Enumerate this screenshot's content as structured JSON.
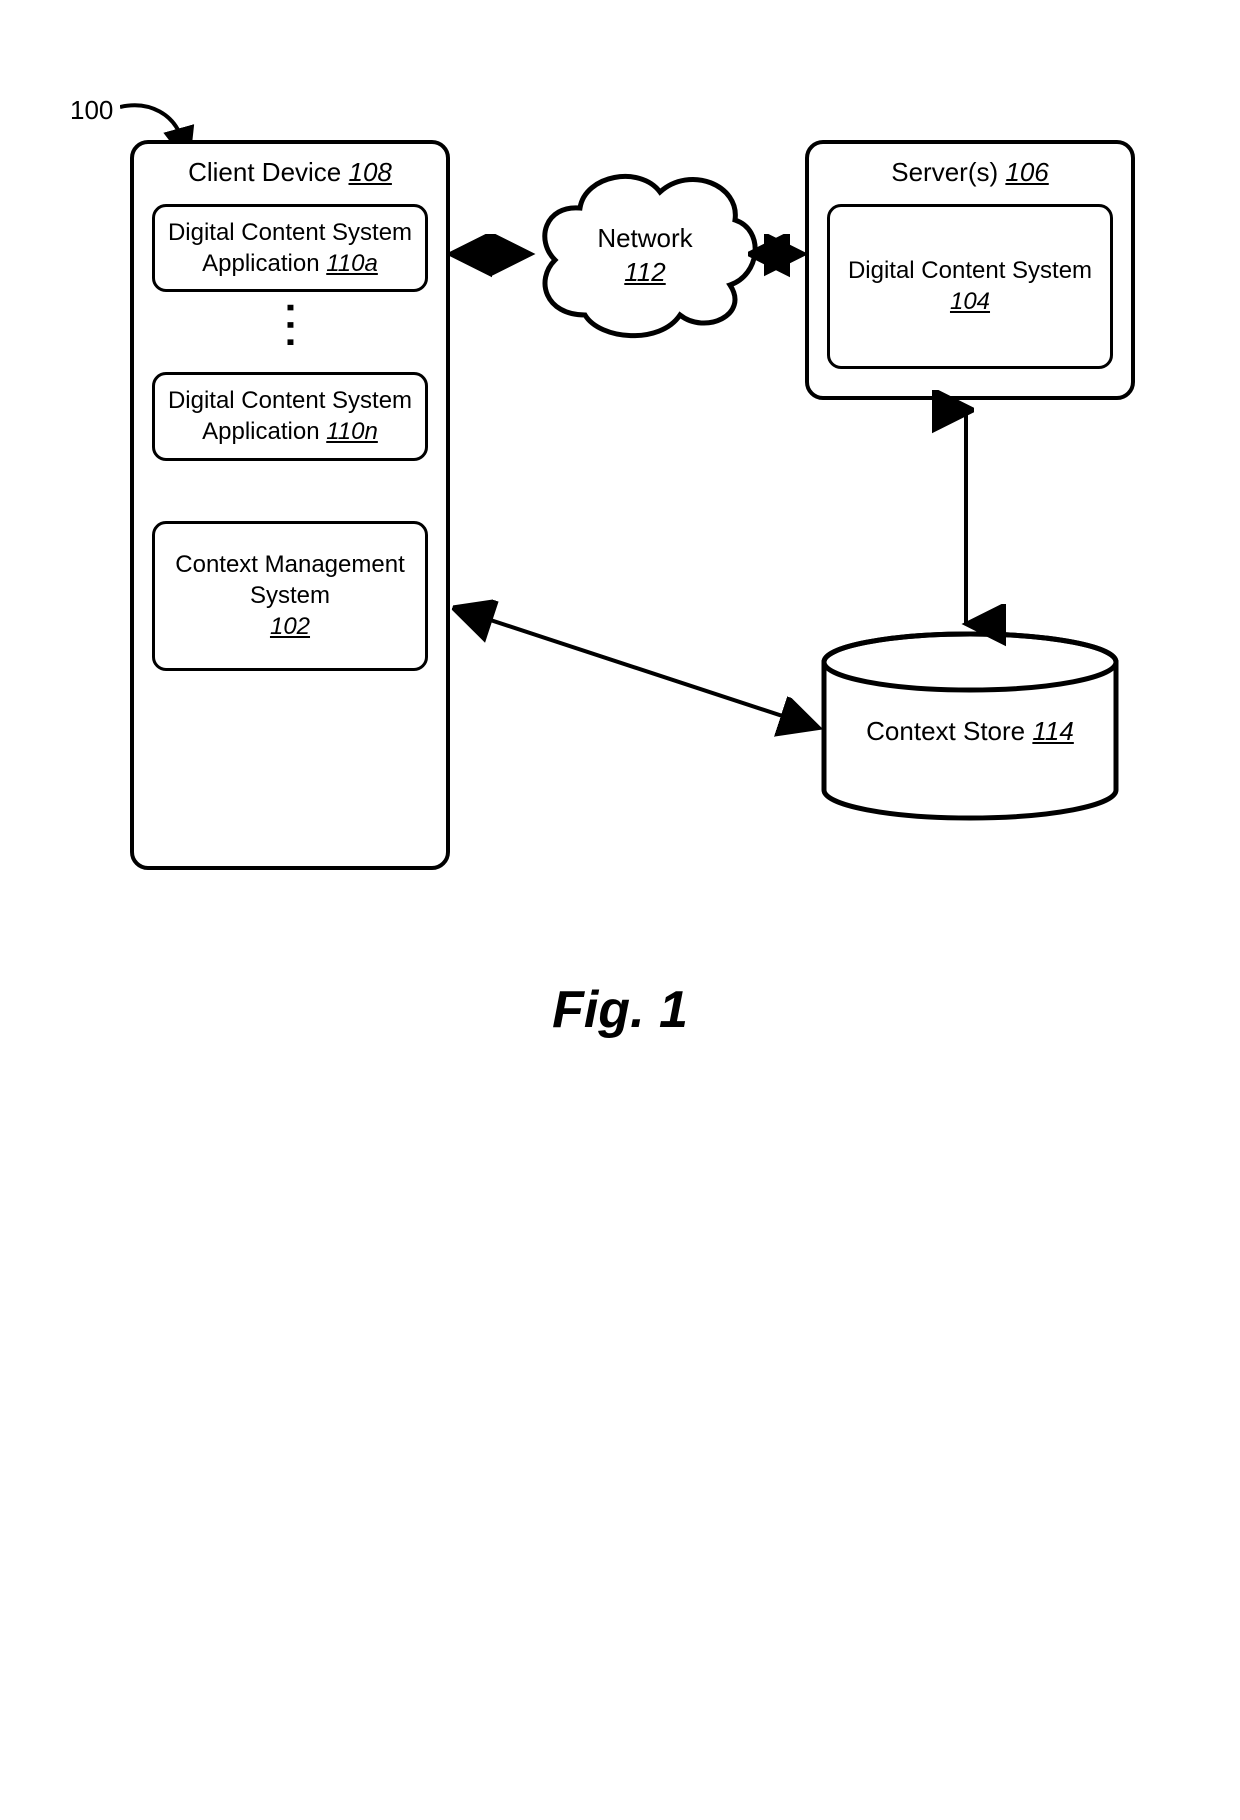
{
  "figure_number": "100",
  "client": {
    "title": "Client Device",
    "ref": "108",
    "app_a": {
      "line1": "Digital Content System",
      "line2": "Application",
      "ref": "110a"
    },
    "app_n": {
      "line1": "Digital Content System",
      "line2": "Application",
      "ref": "110n"
    },
    "cms": {
      "line1": "Context Management System",
      "ref": "102"
    }
  },
  "network": {
    "label": "Network",
    "ref": "112"
  },
  "server": {
    "title": "Server(s)",
    "ref": "106",
    "inner": {
      "line1": "Digital Content System",
      "ref": "104"
    }
  },
  "store": {
    "label": "Context Store",
    "ref": "114"
  },
  "caption": "Fig. 1"
}
